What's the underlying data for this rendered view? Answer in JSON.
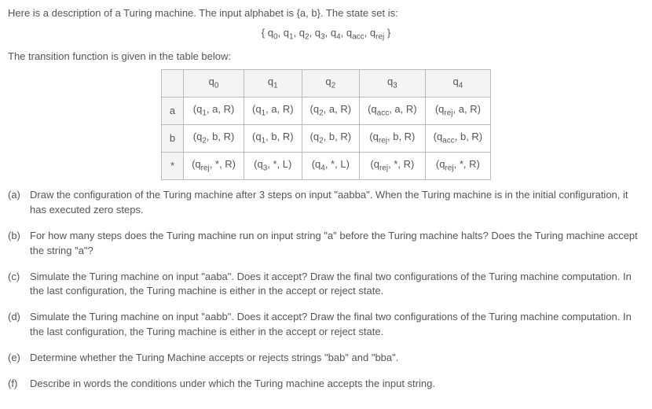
{
  "intro": {
    "line1": "Here is a description of a Turing machine. The input alphabet is {a, b}. The state set is:",
    "stateset_html": "{ q<sub>0</sub>, q<sub>1</sub>, q<sub>2</sub>, q<sub>3</sub>, q<sub>4</sub>, q<sub>acc</sub>, q<sub>rej</sub> }",
    "line2": "The transition function is given in the table below:"
  },
  "table": {
    "col_headers_html": [
      "q<sub>0</sub>",
      "q<sub>1</sub>",
      "q<sub>2</sub>",
      "q<sub>3</sub>",
      "q<sub>4</sub>"
    ],
    "rows": [
      {
        "label": "a",
        "cells_html": [
          "(q<sub>1</sub>, a, R)",
          "(q<sub>1</sub>, a, R)",
          "(q<sub>2</sub>, a, R)",
          "(q<sub>acc</sub>, a, R)",
          "(q<sub>rej</sub>, a, R)"
        ]
      },
      {
        "label": "b",
        "cells_html": [
          "(q<sub>2</sub>, b, R)",
          "(q<sub>1</sub>, b, R)",
          "(q<sub>2</sub>, b, R)",
          "(q<sub>rej</sub>, b, R)",
          "(q<sub>acc</sub>, b, R)"
        ]
      },
      {
        "label": "*",
        "cells_html": [
          "(q<sub>rej</sub>, *, R)",
          "(q<sub>3</sub>, *, L)",
          "(q<sub>4</sub>, *, L)",
          "(q<sub>rej</sub>, *, R)",
          "(q<sub>rej</sub>, *, R)"
        ]
      }
    ]
  },
  "questions": [
    {
      "label": "(a)",
      "text": "Draw the configuration of the Turing machine after 3 steps on input \"aabba\". When the Turing machine is in the initial configuration, it has executed zero steps."
    },
    {
      "label": "(b)",
      "text": "For how many steps does the Turing machine run on input string \"a\" before the Turing machine halts? Does the Turing machine accept the string \"a\"?"
    },
    {
      "label": "(c)",
      "text": "Simulate the Turing machine on input \"aaba\". Does it accept? Draw the final two configurations of the Turing machine computation. In the last configuration, the Turing machine is either in the accept or reject state."
    },
    {
      "label": "(d)",
      "text": "Simulate the Turing machine on input \"aabb\". Does it accept? Draw the final two configurations of the Turing machine computation. In the last configuration, the Turing machine is either in the accept or reject state."
    },
    {
      "label": "(e)",
      "text": "Determine whether the Turing Machine accepts or rejects strings \"bab\" and \"bba\"."
    },
    {
      "label": "(f)",
      "text": "Describe in words the conditions under which the Turing machine accepts the input string."
    }
  ]
}
